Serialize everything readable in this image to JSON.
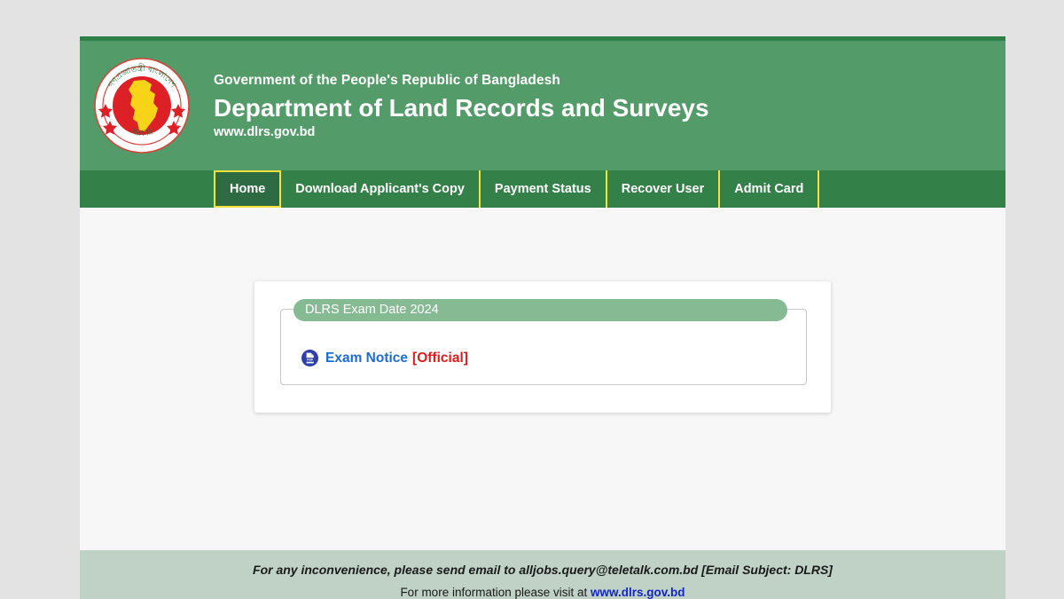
{
  "header": {
    "emblem_name": "bangladesh-national-emblem",
    "emblem_text_top": "গণপ্রজাতন্ত্রী বাংলাদেশ",
    "emblem_text_bottom": "সরকার",
    "gov_line": "Government of the People's Republic of Bangladesh",
    "dept_line": "Department of Land Records and Surveys",
    "url_line": "www.dlrs.gov.bd"
  },
  "nav": {
    "items": [
      {
        "label": "Home",
        "active": true
      },
      {
        "label": "Download Applicant's Copy",
        "active": false
      },
      {
        "label": "Payment Status",
        "active": false
      },
      {
        "label": "Recover User",
        "active": false
      },
      {
        "label": "Admit Card",
        "active": false
      }
    ]
  },
  "main": {
    "panel_title": "DLRS Exam Date 2024",
    "notice": {
      "icon": "pdf-icon",
      "link_label": "Exam Notice",
      "official_label": "[Official]"
    }
  },
  "footer": {
    "line1": "For any inconvenience, please send email to alljobs.query@teletalk.com.bd [Email Subject: DLRS]",
    "line2_prefix": "For more information please visit at ",
    "line2_link": "www.dlrs.gov.bd"
  },
  "colors": {
    "header_green": "#539b68",
    "nav_green": "#338048",
    "nav_active_green": "#2e6b43",
    "nav_border_yellow": "#f5e03c",
    "panel_heading_green": "#85ba93",
    "footer_green": "#bfd2c5",
    "link_blue": "#1c6fd0",
    "official_red": "#e01b1b",
    "page_background": "#f7f7f7",
    "outer_background": "#e3e3e3"
  }
}
